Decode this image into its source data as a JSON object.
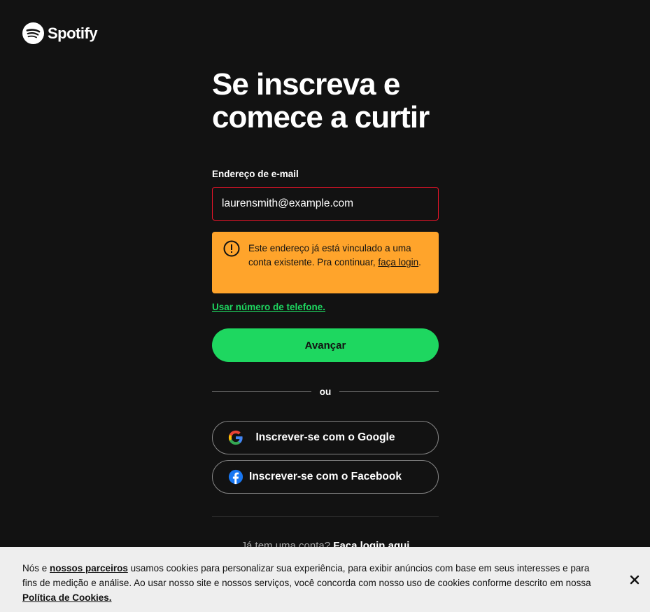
{
  "brand": {
    "name": "Spotify",
    "color": "#1ed760"
  },
  "signup": {
    "title_line1": "Se inscreva e",
    "title_line2": "comece a curtir",
    "email_label": "Endereço de e-mail",
    "email_value": "laurensmith@example.com",
    "error": {
      "icon": "warning-circle-icon",
      "text_before": "Este endereço já está vinculado a uma conta existente. Pra continuar, ",
      "link": "faça login",
      "text_after": "."
    },
    "phone_link": "Usar número de telefone.",
    "next_button": "Avançar",
    "divider": "ou",
    "google_button": "Inscrever-se com o Google",
    "facebook_button": "Inscrever-se com o Facebook",
    "login_prompt": "Já tem uma conta?",
    "login_link": "Faça login aqui"
  },
  "cookies": {
    "text_1": "Nós e ",
    "partners_link": "nossos parceiros",
    "text_2": " usamos cookies para personalizar sua experiência, para exibir anúncios com base em seus interesses e para fins de medição e análise. Ao usar nosso site e nossos serviços, você concorda com nosso uso de cookies conforme descrito em nossa ",
    "policy_link": "Política de Cookies."
  },
  "colors": {
    "background": "#121212",
    "error": "#ffa42b",
    "input_error_border": "#e91429",
    "cookie_bg": "#eeeeee"
  }
}
